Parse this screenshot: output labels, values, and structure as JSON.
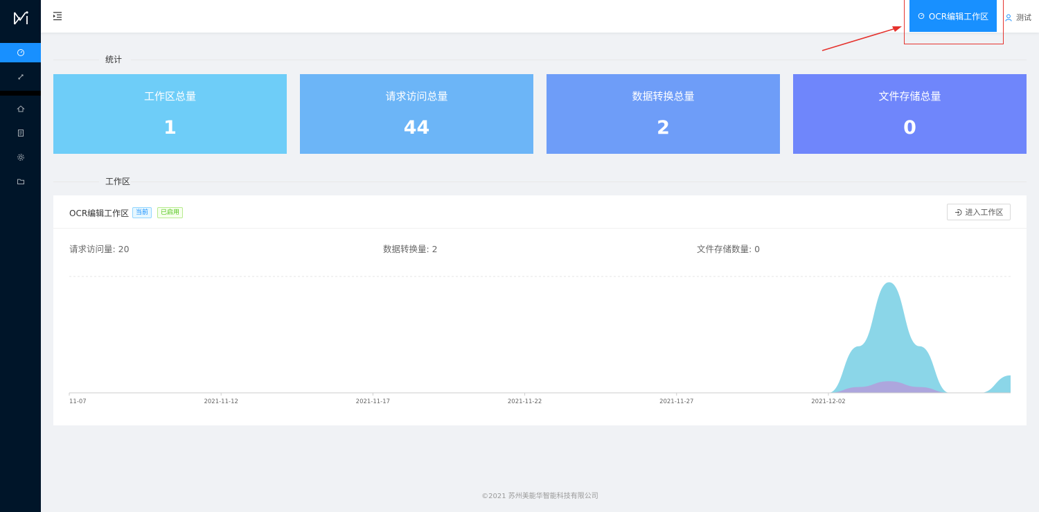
{
  "header": {
    "workspace_button": "OCR编辑工作区",
    "user_name": "测试"
  },
  "sections": {
    "stats_title": "统计",
    "workspace_title": "工作区"
  },
  "stats": [
    {
      "label": "工作区总量",
      "value": "1",
      "color": "#6ecdf8"
    },
    {
      "label": "请求访问总量",
      "value": "44",
      "color": "#6cb5f7"
    },
    {
      "label": "数据转换总量",
      "value": "2",
      "color": "#6e9df8"
    },
    {
      "label": "文件存储总量",
      "value": "0",
      "color": "#6f86fb"
    }
  ],
  "workspace": {
    "name": "OCR编辑工作区",
    "tag_current": "当前",
    "tag_enabled": "已启用",
    "enter_button": "进入工作区",
    "metrics": {
      "requests": "请求访问量: 20",
      "conversions": "数据转换量: 2",
      "storage": "文件存储数量: 0"
    }
  },
  "chart_data": {
    "type": "area",
    "x_ticks": [
      "11-07",
      "2021-11-12",
      "2021-11-17",
      "2021-11-22",
      "2021-11-27",
      "2021-12-02"
    ],
    "x_range": [
      "2021-11-07",
      "2021-12-08"
    ],
    "series": [
      {
        "color": "#7ed2e6",
        "points": [
          [
            "2021-12-02",
            0
          ],
          [
            "2021-12-03",
            8
          ],
          [
            "2021-12-04",
            19
          ],
          [
            "2021-12-05",
            8
          ],
          [
            "2021-12-06",
            0
          ],
          [
            "2021-12-07",
            0
          ],
          [
            "2021-12-08",
            3
          ]
        ]
      },
      {
        "color": "#b39ddb",
        "points": [
          [
            "2021-12-02",
            0
          ],
          [
            "2021-12-03",
            1
          ],
          [
            "2021-12-04",
            2
          ],
          [
            "2021-12-05",
            1
          ],
          [
            "2021-12-06",
            0
          ]
        ]
      }
    ],
    "ylim": [
      0,
      20
    ]
  },
  "footer": {
    "copyright": "©2021 苏州美能华智能科技有限公司"
  }
}
